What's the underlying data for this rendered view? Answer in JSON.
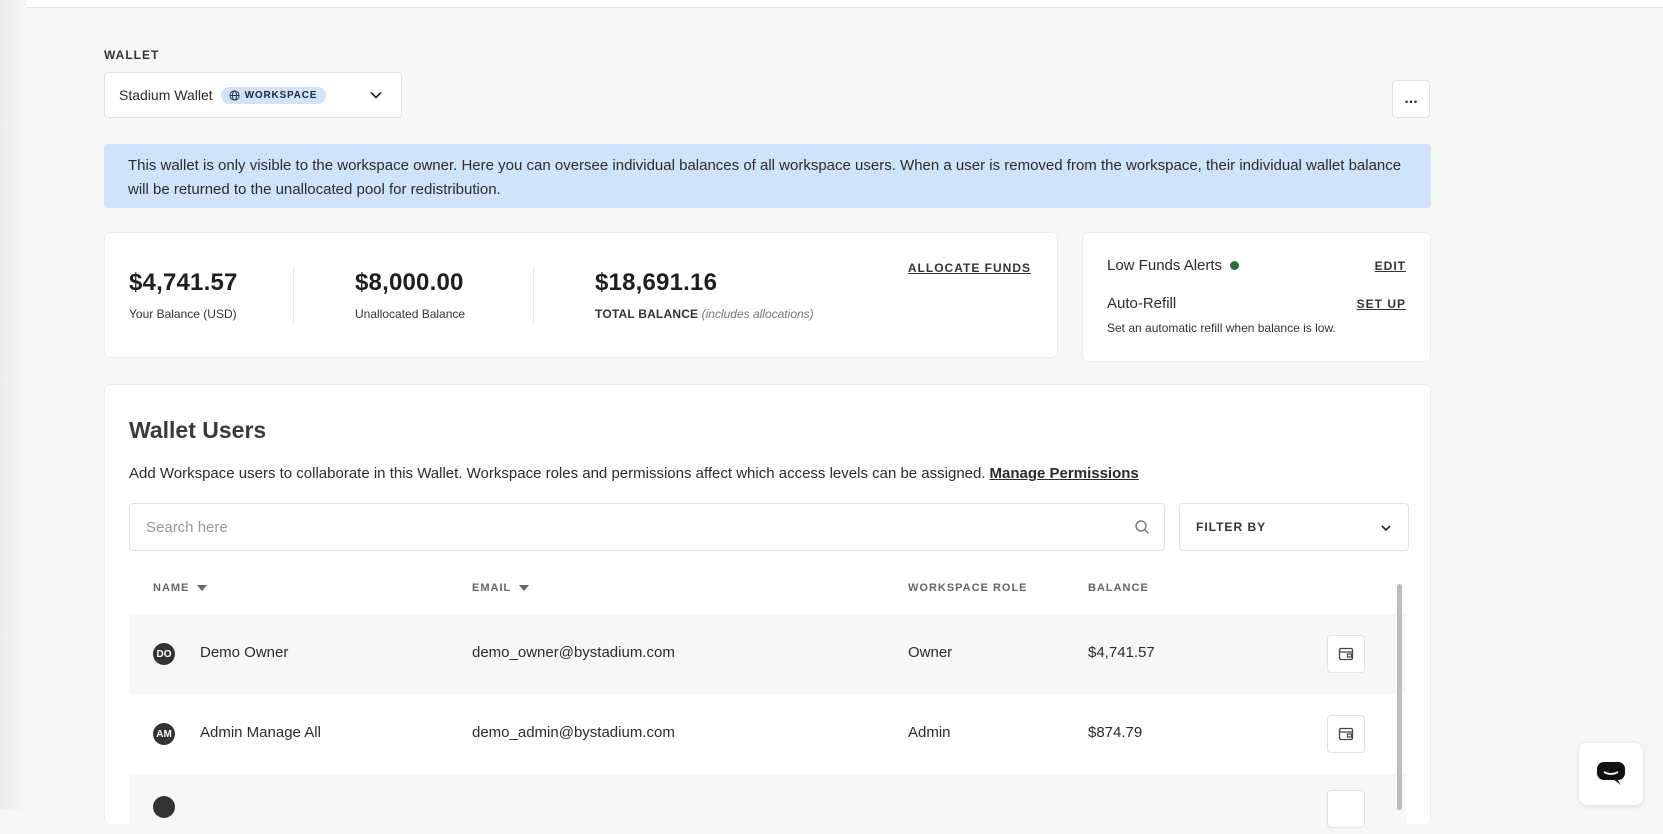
{
  "wallet": {
    "section_label": "WALLET",
    "selected_wallet": "Stadium Wallet",
    "badge_label": "WORKSPACE",
    "more_label": "..."
  },
  "banner": {
    "text": "This wallet is only visible to the workspace owner. Here you can oversee individual balances of all workspace users. When a user is removed from the workspace, their individual wallet balance will be returned to the unallocated pool for redistribution."
  },
  "balances": {
    "your_balance": "$4,741.57",
    "your_balance_label": "Your Balance (USD)",
    "unallocated": "$8,000.00",
    "unallocated_label": "Unallocated Balance",
    "total": "$18,691.16",
    "total_label": "TOTAL BALANCE",
    "total_note": "(includes allocations)",
    "allocate_link": "ALLOCATE FUNDS"
  },
  "alerts": {
    "low_funds_label": "Low Funds Alerts",
    "low_funds_status_color": "#2e6b3f",
    "edit_link": "EDIT",
    "auto_refill_label": "Auto-Refill",
    "setup_link": "SET UP",
    "auto_refill_desc": "Set an automatic refill when balance is low."
  },
  "users": {
    "title": "Wallet Users",
    "description": "Add Workspace users to collaborate in this Wallet. Workspace roles and permissions affect which access levels can be assigned.",
    "manage_link": "Manage Permissions",
    "search_placeholder": "Search here",
    "filter_label": "FILTER BY",
    "columns": {
      "name": "NAME",
      "email": "EMAIL",
      "role": "WORKSPACE ROLE",
      "balance": "BALANCE"
    },
    "rows": [
      {
        "initials": "DO",
        "name": "Demo Owner",
        "email": "demo_owner@bystadium.com",
        "role": "Owner",
        "balance": "$4,741.57"
      },
      {
        "initials": "AM",
        "name": "Admin Manage All",
        "email": "demo_admin@bystadium.com",
        "role": "Admin",
        "balance": "$874.79"
      }
    ]
  },
  "colors": {
    "accent_banner": "#cfe3fb",
    "background": "#f7f7f7"
  }
}
